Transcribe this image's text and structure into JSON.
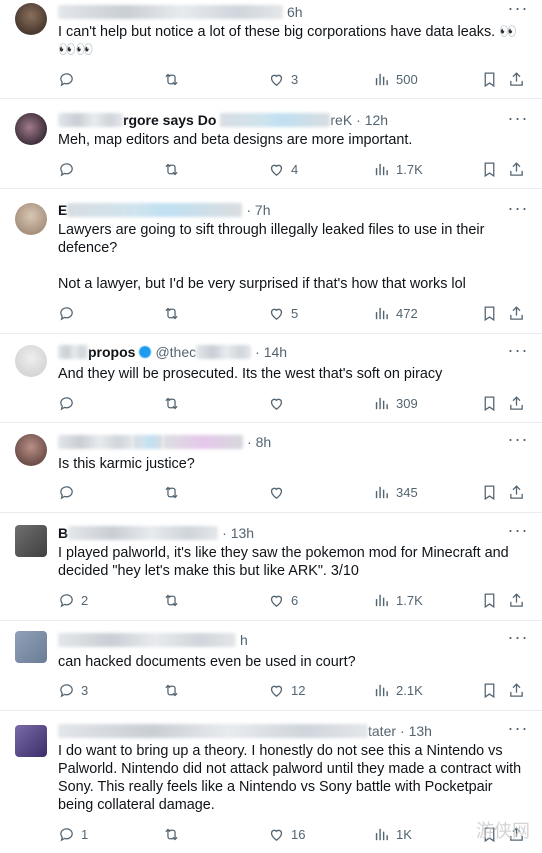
{
  "posts": [
    {
      "time": "6h",
      "text": "I can't help but notice a lot of these big corporations have data leaks. 👀👀👀",
      "reply": "",
      "like": "3",
      "views": "500"
    },
    {
      "time": "12h",
      "frag": "rgore says Do",
      "frag2": "reK",
      "text": "Meh, map editors and beta designs are more important.",
      "reply": "",
      "like": "4",
      "views": "1.7K"
    },
    {
      "time": "7h",
      "frag": "E",
      "text": "Lawyers are going to sift through illegally leaked files to use in their defence?\n\nNot a lawyer, but I'd be very surprised if that's how that works lol",
      "reply": "",
      "like": "5",
      "views": "472"
    },
    {
      "time": "14h",
      "frag": "propos",
      "frag2": "@thec",
      "text": "And they will be prosecuted. Its the west that's soft on piracy",
      "reply": "",
      "like": "",
      "views": "309"
    },
    {
      "time": "8h",
      "text": "Is this karmic justice?",
      "reply": "",
      "like": "",
      "views": "345"
    },
    {
      "time": "13h",
      "frag": "B",
      "text": "I played palworld, it's like they saw the pokemon mod for Minecraft and decided \"hey let's make this but like ARK\". 3/10",
      "reply": "2",
      "like": "6",
      "views": "1.7K"
    },
    {
      "time": "h",
      "text": "can hacked documents even be used in court?",
      "reply": "3",
      "like": "12",
      "views": "2.1K"
    },
    {
      "time": "13h",
      "frag": "tater",
      "text": "I do want to bring up a theory. I honestly do not see this a Nintendo vs Palworld. Nintendo did not attack palword until they made a contract with Sony. This really feels like a Nintendo vs Sony battle with Pocketpair being collateral damage.",
      "reply": "1",
      "like": "16",
      "views": "1K"
    }
  ],
  "icons": [
    "reply-icon",
    "retweet-icon",
    "like-icon",
    "views-icon",
    "bookmark-icon",
    "share-icon",
    "more-icon"
  ],
  "watermark": "游侠网"
}
